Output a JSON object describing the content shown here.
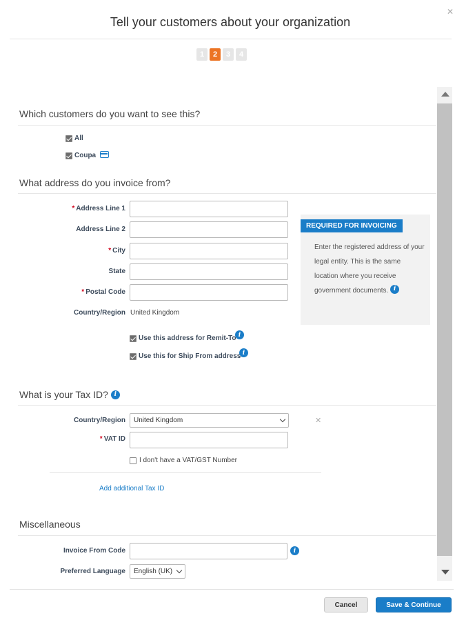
{
  "dialog": {
    "title": "Tell your customers about your organization",
    "close_icon": "close-icon"
  },
  "steps": [
    {
      "label": "1",
      "active": false
    },
    {
      "label": "2",
      "active": true
    },
    {
      "label": "3",
      "active": false
    },
    {
      "label": "4",
      "active": false
    }
  ],
  "customers": {
    "heading": "Which customers do you want to see this?",
    "options": [
      {
        "label": "All",
        "checked": true
      },
      {
        "label": "Coupa",
        "checked": true,
        "icon": "card-icon"
      }
    ]
  },
  "address": {
    "heading": "What address do you invoice from?",
    "fields": {
      "line1": {
        "label": "Address Line 1",
        "required": true,
        "value": ""
      },
      "line2": {
        "label": "Address Line 2",
        "required": false,
        "value": ""
      },
      "city": {
        "label": "City",
        "required": true,
        "value": ""
      },
      "state": {
        "label": "State",
        "required": false,
        "value": ""
      },
      "postal": {
        "label": "Postal Code",
        "required": true,
        "value": ""
      },
      "country": {
        "label": "Country/Region",
        "value": "United Kingdom"
      }
    },
    "remit_to": {
      "label": "Use this address for Remit-To",
      "checked": true
    },
    "ship_from": {
      "label": "Use this for Ship From address",
      "checked": true
    },
    "info_panel": {
      "badge": "REQUIRED FOR INVOICING",
      "text": "Enter the registered address of your legal entity. This is the same location where you receive government documents."
    }
  },
  "tax": {
    "heading": "What is your Tax ID?",
    "country_label": "Country/Region",
    "country_value": "United Kingdom",
    "vat_label": "VAT ID",
    "vat_value": "",
    "no_vat_label": "I don't have a VAT/GST Number",
    "no_vat_checked": false,
    "add_link": "Add additional Tax ID",
    "remove_icon": "close-icon"
  },
  "misc": {
    "heading": "Miscellaneous",
    "invoice_from_code_label": "Invoice From Code",
    "invoice_from_code_value": "",
    "language_label": "Preferred Language",
    "language_value": "English (UK)"
  },
  "footer": {
    "cancel_label": "Cancel",
    "save_label": "Save & Continue"
  },
  "colors": {
    "accent": "#1a7dc8",
    "active_step": "#ec7424",
    "required": "#d0021b"
  }
}
